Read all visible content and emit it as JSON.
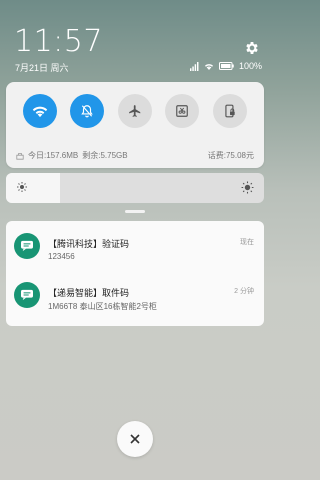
{
  "status": {
    "time": "11:57",
    "date": "7月21日 周六",
    "battery": "100%"
  },
  "quick_settings": {
    "tiles": [
      {
        "icon": "wifi-icon",
        "state": "on"
      },
      {
        "icon": "bell-muted-icon",
        "state": "on"
      },
      {
        "icon": "airplane-icon",
        "state": "off"
      },
      {
        "icon": "screenshot-icon",
        "state": "off"
      },
      {
        "icon": "phone-lock-icon",
        "state": "off"
      }
    ],
    "data_today": "今日:157.6MB",
    "data_remaining": "剩余:5.75GB",
    "balance": "话费:75.08元"
  },
  "brightness": {
    "level": 0.21
  },
  "notifications": [
    {
      "title": "【腾讯科技】验证码",
      "body": "123456",
      "time": "现在",
      "icon": "sms-icon"
    },
    {
      "title": "【递易智能】取件码",
      "body": "1M66T8 泰山区16栋智能2号柜",
      "time": "2 分钟",
      "icon": "sms-icon"
    }
  ],
  "colors": {
    "accent": "#2196e9",
    "app_icon": "#189574"
  }
}
